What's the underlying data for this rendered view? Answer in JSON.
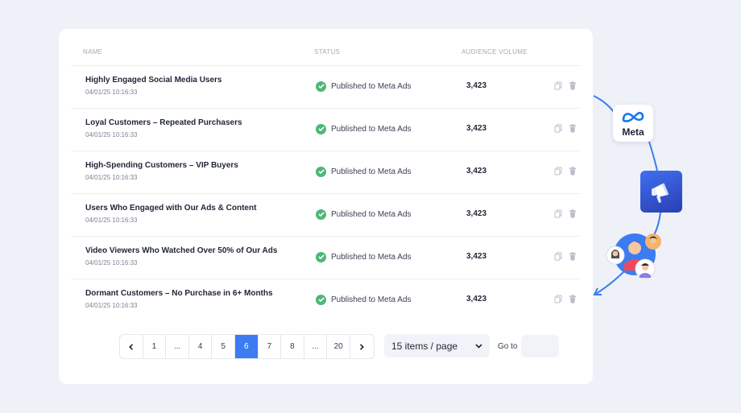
{
  "table": {
    "headers": {
      "name": "NAME",
      "status": "STATUS",
      "audience": "AUDIENCE VOLUME"
    },
    "rows": [
      {
        "name": "Highly Engaged Social Media Users",
        "date": "04/01/25 10:16:33",
        "status": "Published to Meta Ads",
        "volume": "3,423"
      },
      {
        "name": "Loyal Customers – Repeated Purchasers",
        "date": "04/01/25 10:16:33",
        "status": "Published to Meta Ads",
        "volume": "3,423"
      },
      {
        "name": "High-Spending Customers – VIP Buyers",
        "date": "04/01/25 10:16:33",
        "status": "Published to Meta Ads",
        "volume": "3,423"
      },
      {
        "name": "Users Who Engaged with Our Ads & Content",
        "date": "04/01/25 10:16:33",
        "status": "Published to Meta Ads",
        "volume": "3,423"
      },
      {
        "name": "Video Viewers Who Watched Over 50% of Our Ads",
        "date": "04/01/25 10:16:33",
        "status": "Published to Meta Ads",
        "volume": "3,423"
      },
      {
        "name": "Dormant Customers – No Purchase in 6+ Months",
        "date": "04/01/25 10:16:33",
        "status": "Published to Meta Ads",
        "volume": "3,423"
      }
    ],
    "row_icons": [
      "copy-icon",
      "trash-icon"
    ]
  },
  "pagination": {
    "prev": "‹",
    "pages": [
      "1",
      "...",
      "4",
      "5",
      "6",
      "7",
      "8",
      "...",
      "20"
    ],
    "active_page": "6",
    "next": "›",
    "per_page": "15 items / page",
    "goto_label": "Go to",
    "goto_value": ""
  },
  "integration": {
    "meta_label": "Meta",
    "icons": [
      "meta-logo-icon",
      "megaphone-icon",
      "audience-group-icon"
    ]
  },
  "colors": {
    "background": "#eff1f8",
    "accent": "#3d7bf3",
    "success": "#4cb877",
    "connector": "#3a7bf0"
  }
}
